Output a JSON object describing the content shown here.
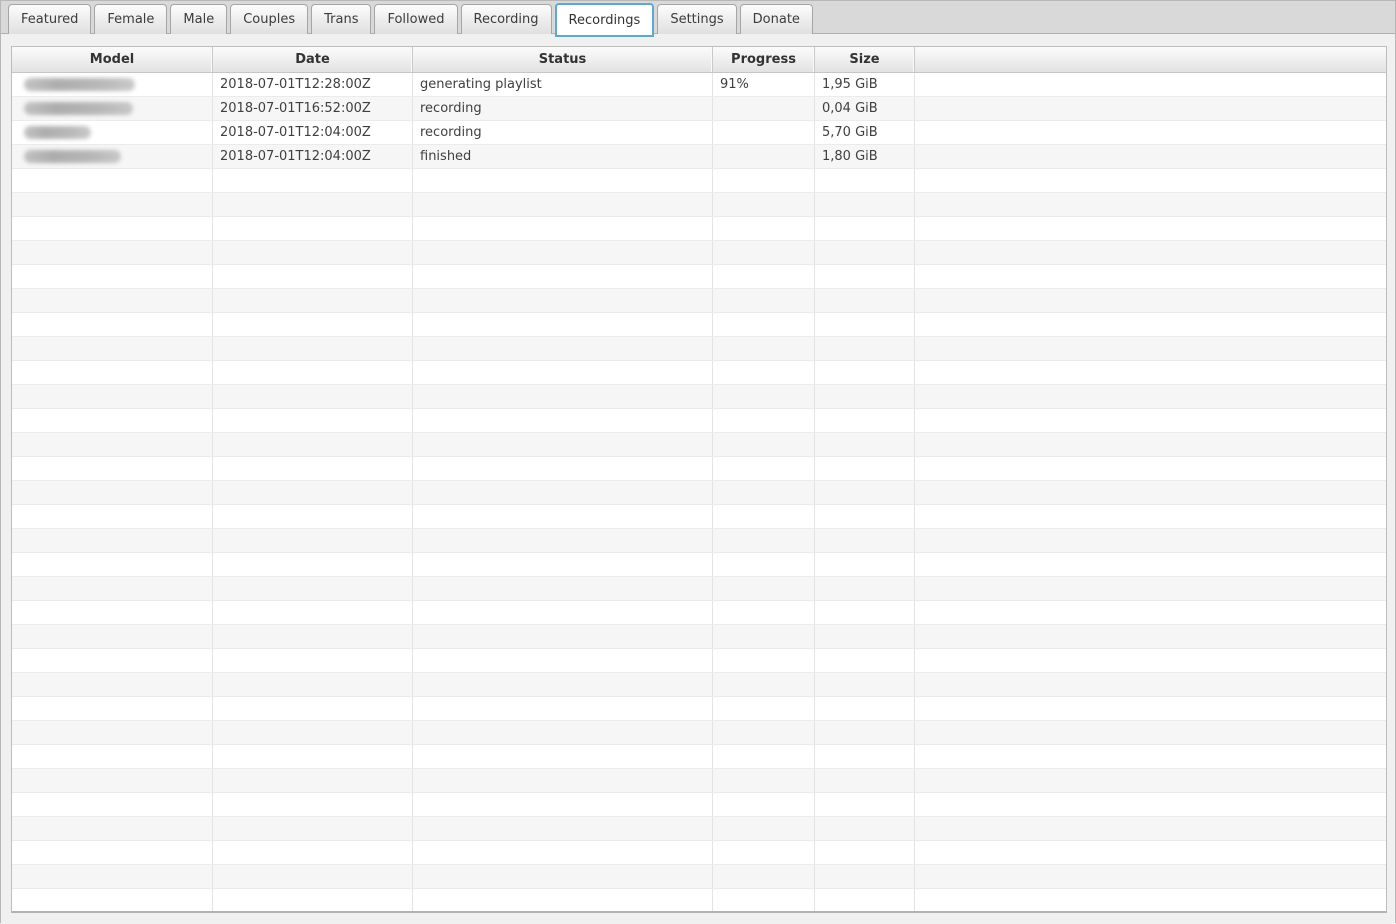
{
  "tabs": [
    {
      "label": "Featured",
      "active": false
    },
    {
      "label": "Female",
      "active": false
    },
    {
      "label": "Male",
      "active": false
    },
    {
      "label": "Couples",
      "active": false
    },
    {
      "label": "Trans",
      "active": false
    },
    {
      "label": "Followed",
      "active": false
    },
    {
      "label": "Recording",
      "active": false
    },
    {
      "label": "Recordings",
      "active": true
    },
    {
      "label": "Settings",
      "active": false
    },
    {
      "label": "Donate",
      "active": false
    }
  ],
  "table": {
    "columns": [
      "Model",
      "Date",
      "Status",
      "Progress",
      "Size",
      ""
    ],
    "rows": [
      {
        "model_redacted": true,
        "model_redacted_width": 111,
        "date": "2018-07-01T12:28:00Z",
        "status": "generating playlist",
        "progress": "91%",
        "size": "1,95 GiB"
      },
      {
        "model_redacted": true,
        "model_redacted_width": 109,
        "date": "2018-07-01T16:52:00Z",
        "status": "recording",
        "progress": "",
        "size": "0,04 GiB"
      },
      {
        "model_redacted": true,
        "model_redacted_width": 67,
        "date": "2018-07-01T12:04:00Z",
        "status": "recording",
        "progress": "",
        "size": "5,70 GiB"
      },
      {
        "model_redacted": true,
        "model_redacted_width": 97,
        "date": "2018-07-01T12:04:00Z",
        "status": "finished",
        "progress": "",
        "size": "1,80 GiB"
      }
    ],
    "empty_row_count": 30
  },
  "colors": {
    "active_tab_border": "#5da9d4",
    "tabbar_background": "#d9d9d9",
    "row_stripe": "#f6f6f6",
    "header_text": "#333333",
    "cell_text": "#3f3f3f",
    "table_border": "#bdbdbd"
  }
}
